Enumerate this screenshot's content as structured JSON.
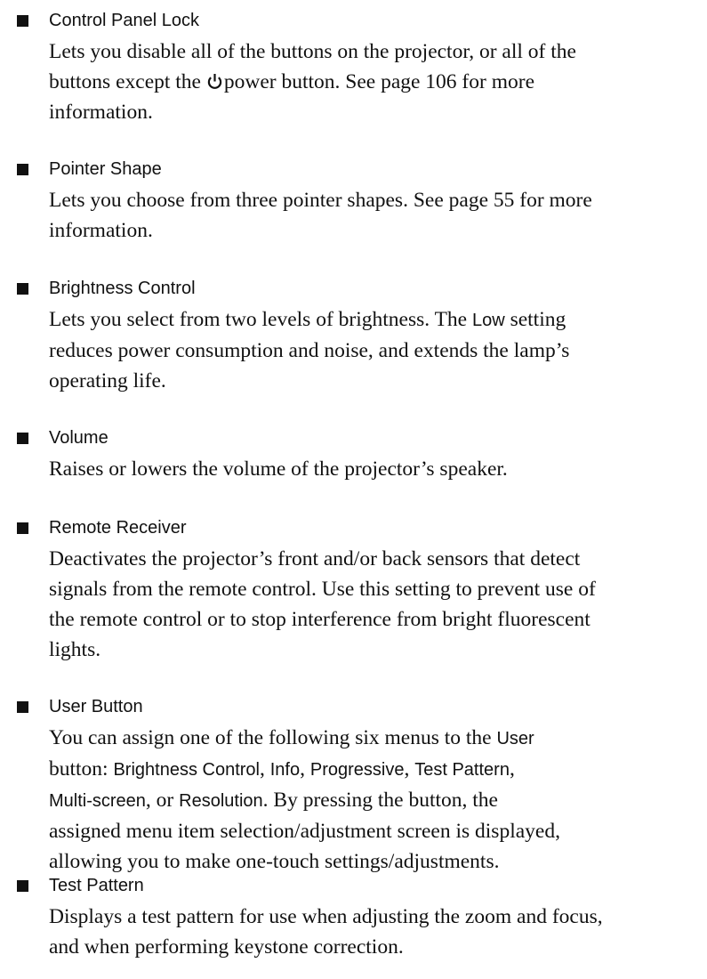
{
  "items": [
    {
      "heading": "Control Panel Lock",
      "line1_a": "Lets you disable all of the buttons on the projector, or all of the",
      "line2_a": "buttons except the",
      "power_icon": "power-icon",
      "line2_b": "power button. See page 106 for more",
      "line3": "information."
    },
    {
      "heading": "Pointer Shape",
      "line1": "Lets you choose from three pointer shapes. See page 55 for more",
      "line2": "information."
    },
    {
      "heading": "Brightness Control",
      "line1_a": "Lets you select from two levels of brightness. The",
      "line1_low": "Low",
      "line1_b": "setting",
      "line2": "reduces power consumption and noise, and extends the lamp’s",
      "line3": "operating life."
    },
    {
      "heading": "Volume",
      "line1": "Raises or lowers the volume of the projector’s speaker."
    },
    {
      "heading": "Remote Receiver",
      "line1": "Deactivates the projector’s front and/or back sensors that detect",
      "line2": "signals from the remote control. Use this setting to prevent use of",
      "line3": "the remote control or to stop interference from bright fluorescent",
      "line4": "lights."
    },
    {
      "heading": "User Button",
      "line1_a": "You can assign one of the following six menus to the",
      "line1_user": "User",
      "line2_a": "button:",
      "menu_brightness": "Brightness Control",
      "line2_comma1": ",",
      "menu_info": "Info",
      "line2_comma2": ",",
      "menu_progressive": "Progressive",
      "line2_comma3": ",",
      "menu_test_pattern": "Test Pattern",
      "line2_comma4": ",",
      "menu_multiscreen": "Multi-screen",
      "line3_or": ", or",
      "menu_resolution": "Resolution",
      "line3_b": ". By pressing the button, the",
      "line4": "assigned menu item selection/adjustment screen is displayed,",
      "line5": "allowing you to make one-touch settings/adjustments."
    },
    {
      "heading": "Test Pattern",
      "line1": "Displays a test pattern for use when adjusting the zoom and focus,",
      "line2": "and when performing keystone correction."
    }
  ]
}
